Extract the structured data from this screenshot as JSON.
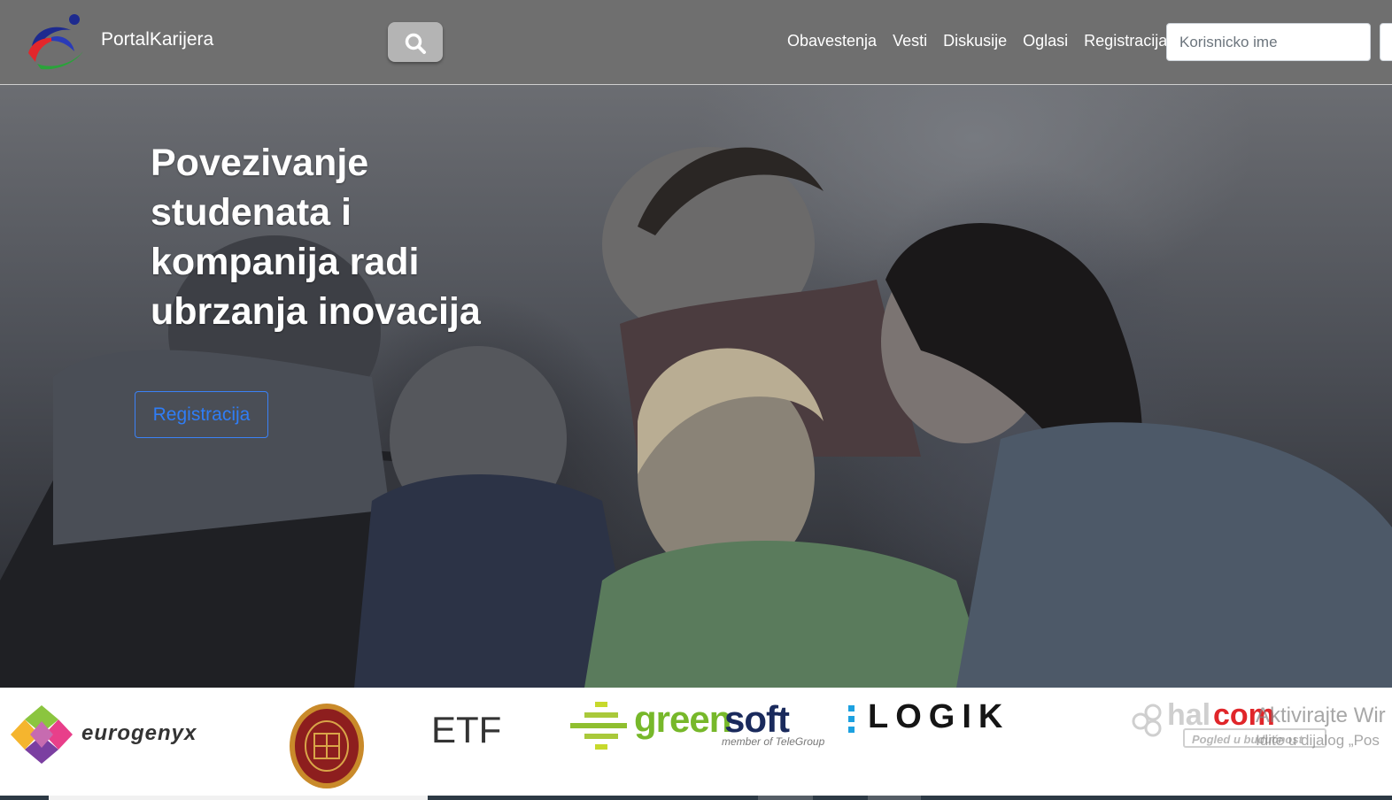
{
  "navbar": {
    "brand": "PortalKarijera",
    "search_icon": "search-icon",
    "links": [
      "Obavestenja",
      "Vesti",
      "Diskusije",
      "Oglasi",
      "Registracija"
    ],
    "username_placeholder": "Korisnicko ime"
  },
  "hero": {
    "title": "Povezivanje studenata i kompanija radi ubrzanja inovacija",
    "button_label": "Registracija"
  },
  "sponsors": {
    "eurogenyx": "eurogenyx",
    "etf": "ETF",
    "greensoft_green": "green",
    "greensoft_soft": "soft",
    "greensoft_sub": "member of TeleGroup",
    "logik": "LOGIK",
    "halcom_hal": "hal",
    "halcom_com": "com",
    "halcom_tag": "Pogled u budućnost"
  },
  "watermark": {
    "line1": "Aktivirajte Wir",
    "line2": "Idite u dijalog „Pos"
  },
  "colors": {
    "navbar_bg": "#6f6f6f",
    "accent_blue": "#2f7df6",
    "greensoft_green": "#77b82a",
    "halcom_red": "#e0262a"
  }
}
